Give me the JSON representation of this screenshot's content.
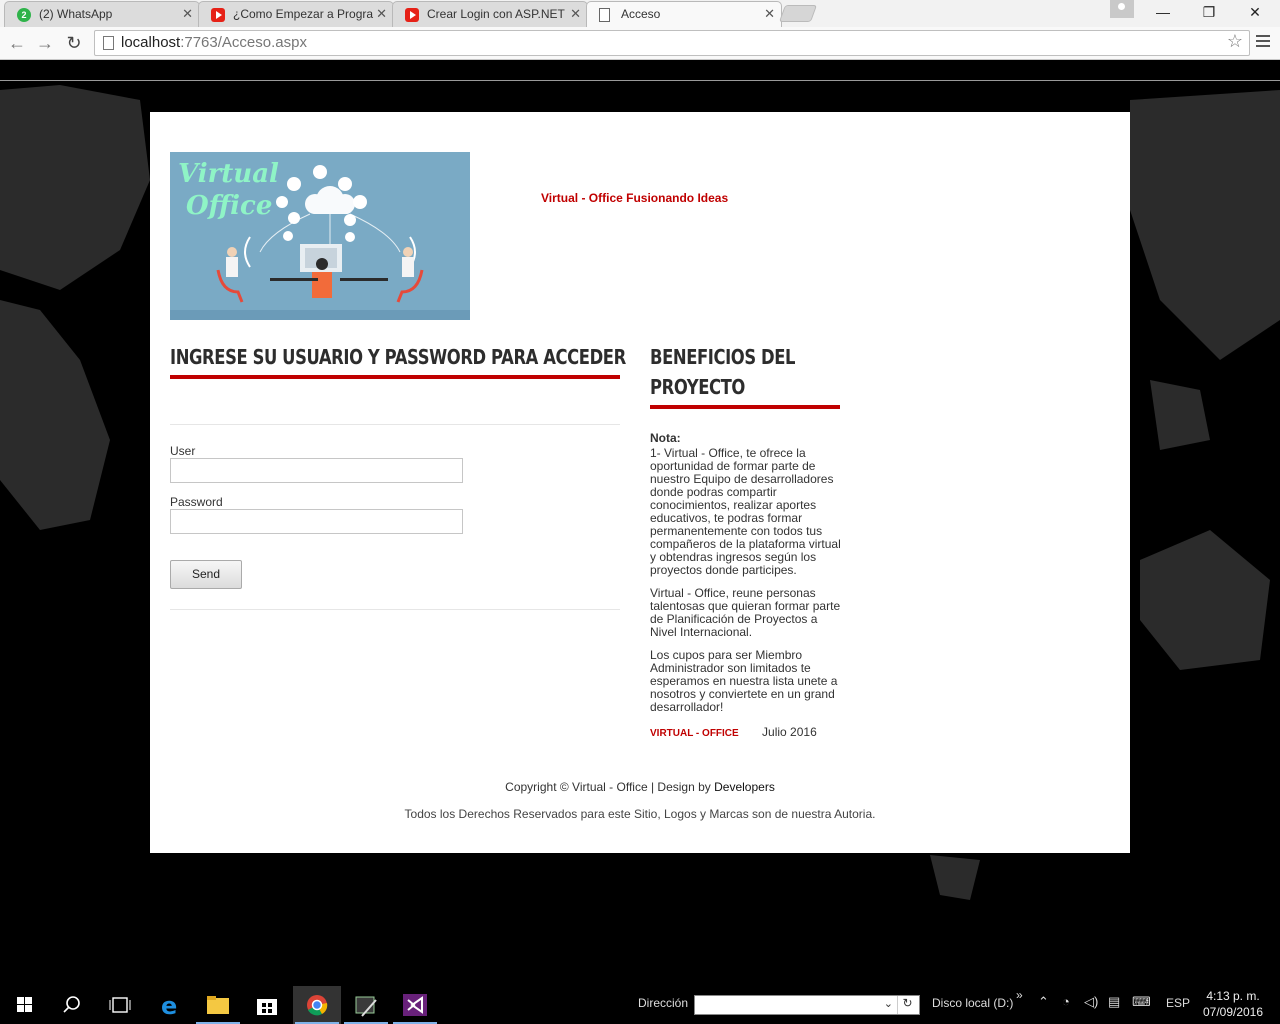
{
  "browser": {
    "tabs": [
      {
        "title": "(2) WhatsApp",
        "badge": "2",
        "icon": "whatsapp-icon",
        "active": false
      },
      {
        "title": "¿Como Empezar a Progra",
        "icon": "youtube-icon",
        "active": false
      },
      {
        "title": "Crear Login con ASP.NET",
        "icon": "youtube-icon",
        "active": false
      },
      {
        "title": "Acceso",
        "icon": "document-icon",
        "active": true
      }
    ],
    "url_host": "localhost",
    "url_rest": ":7763/Acceso.aspx"
  },
  "page": {
    "banner_title_line1": "Virtual",
    "banner_title_line2": "Office",
    "tagline": "Virtual - Office Fusionando Ideas",
    "login": {
      "heading": "INGRESE SU USUARIO Y PASSWORD PARA ACCEDER",
      "user_label": "User",
      "user_value": "",
      "password_label": "Password",
      "password_value": "",
      "send_label": "Send"
    },
    "benefits": {
      "heading_line1": "BENEFICIOS DEL",
      "heading_line2": "PROYECTO",
      "nota_label": "Nota:",
      "paragraph1": "1- Virtual - Office, te ofrece la oportunidad de formar parte de nuestro Equipo de desarrolladores donde podras compartir conocimientos, realizar aportes educativos, te podras formar permanentemente con todos tus compañeros de la plataforma virtual y obtendras ingresos según los proyectos donde participes.",
      "paragraph2": "Virtual - Office, reune personas talentosas que quieran formar parte de Planificación de Proyectos a Nivel Internacional.",
      "paragraph3": "Los cupos para ser Miembro Administrador son limitados te esperamos en nuestra lista unete a nosotros y conviertete en un grand desarrollador!",
      "brand": "VIRTUAL - OFFICE",
      "date": "Julio 2016"
    },
    "footer": {
      "copyright": "Copyright © Virtual - Office | Design by",
      "designer": "Developers",
      "rights": "Todos los Derechos Reservados para este Sitio, Logos y Marcas son de nuestra Autoria."
    }
  },
  "taskbar": {
    "address_label": "Dirección",
    "address_value": "",
    "disk_label": "Disco local (D:)",
    "language": "ESP",
    "time": "4:13 p. m.",
    "date": "07/09/2016"
  },
  "colors": {
    "accent_red": "#c00000",
    "banner_blue": "#7aaac5",
    "banner_title": "#8ff4c6"
  }
}
